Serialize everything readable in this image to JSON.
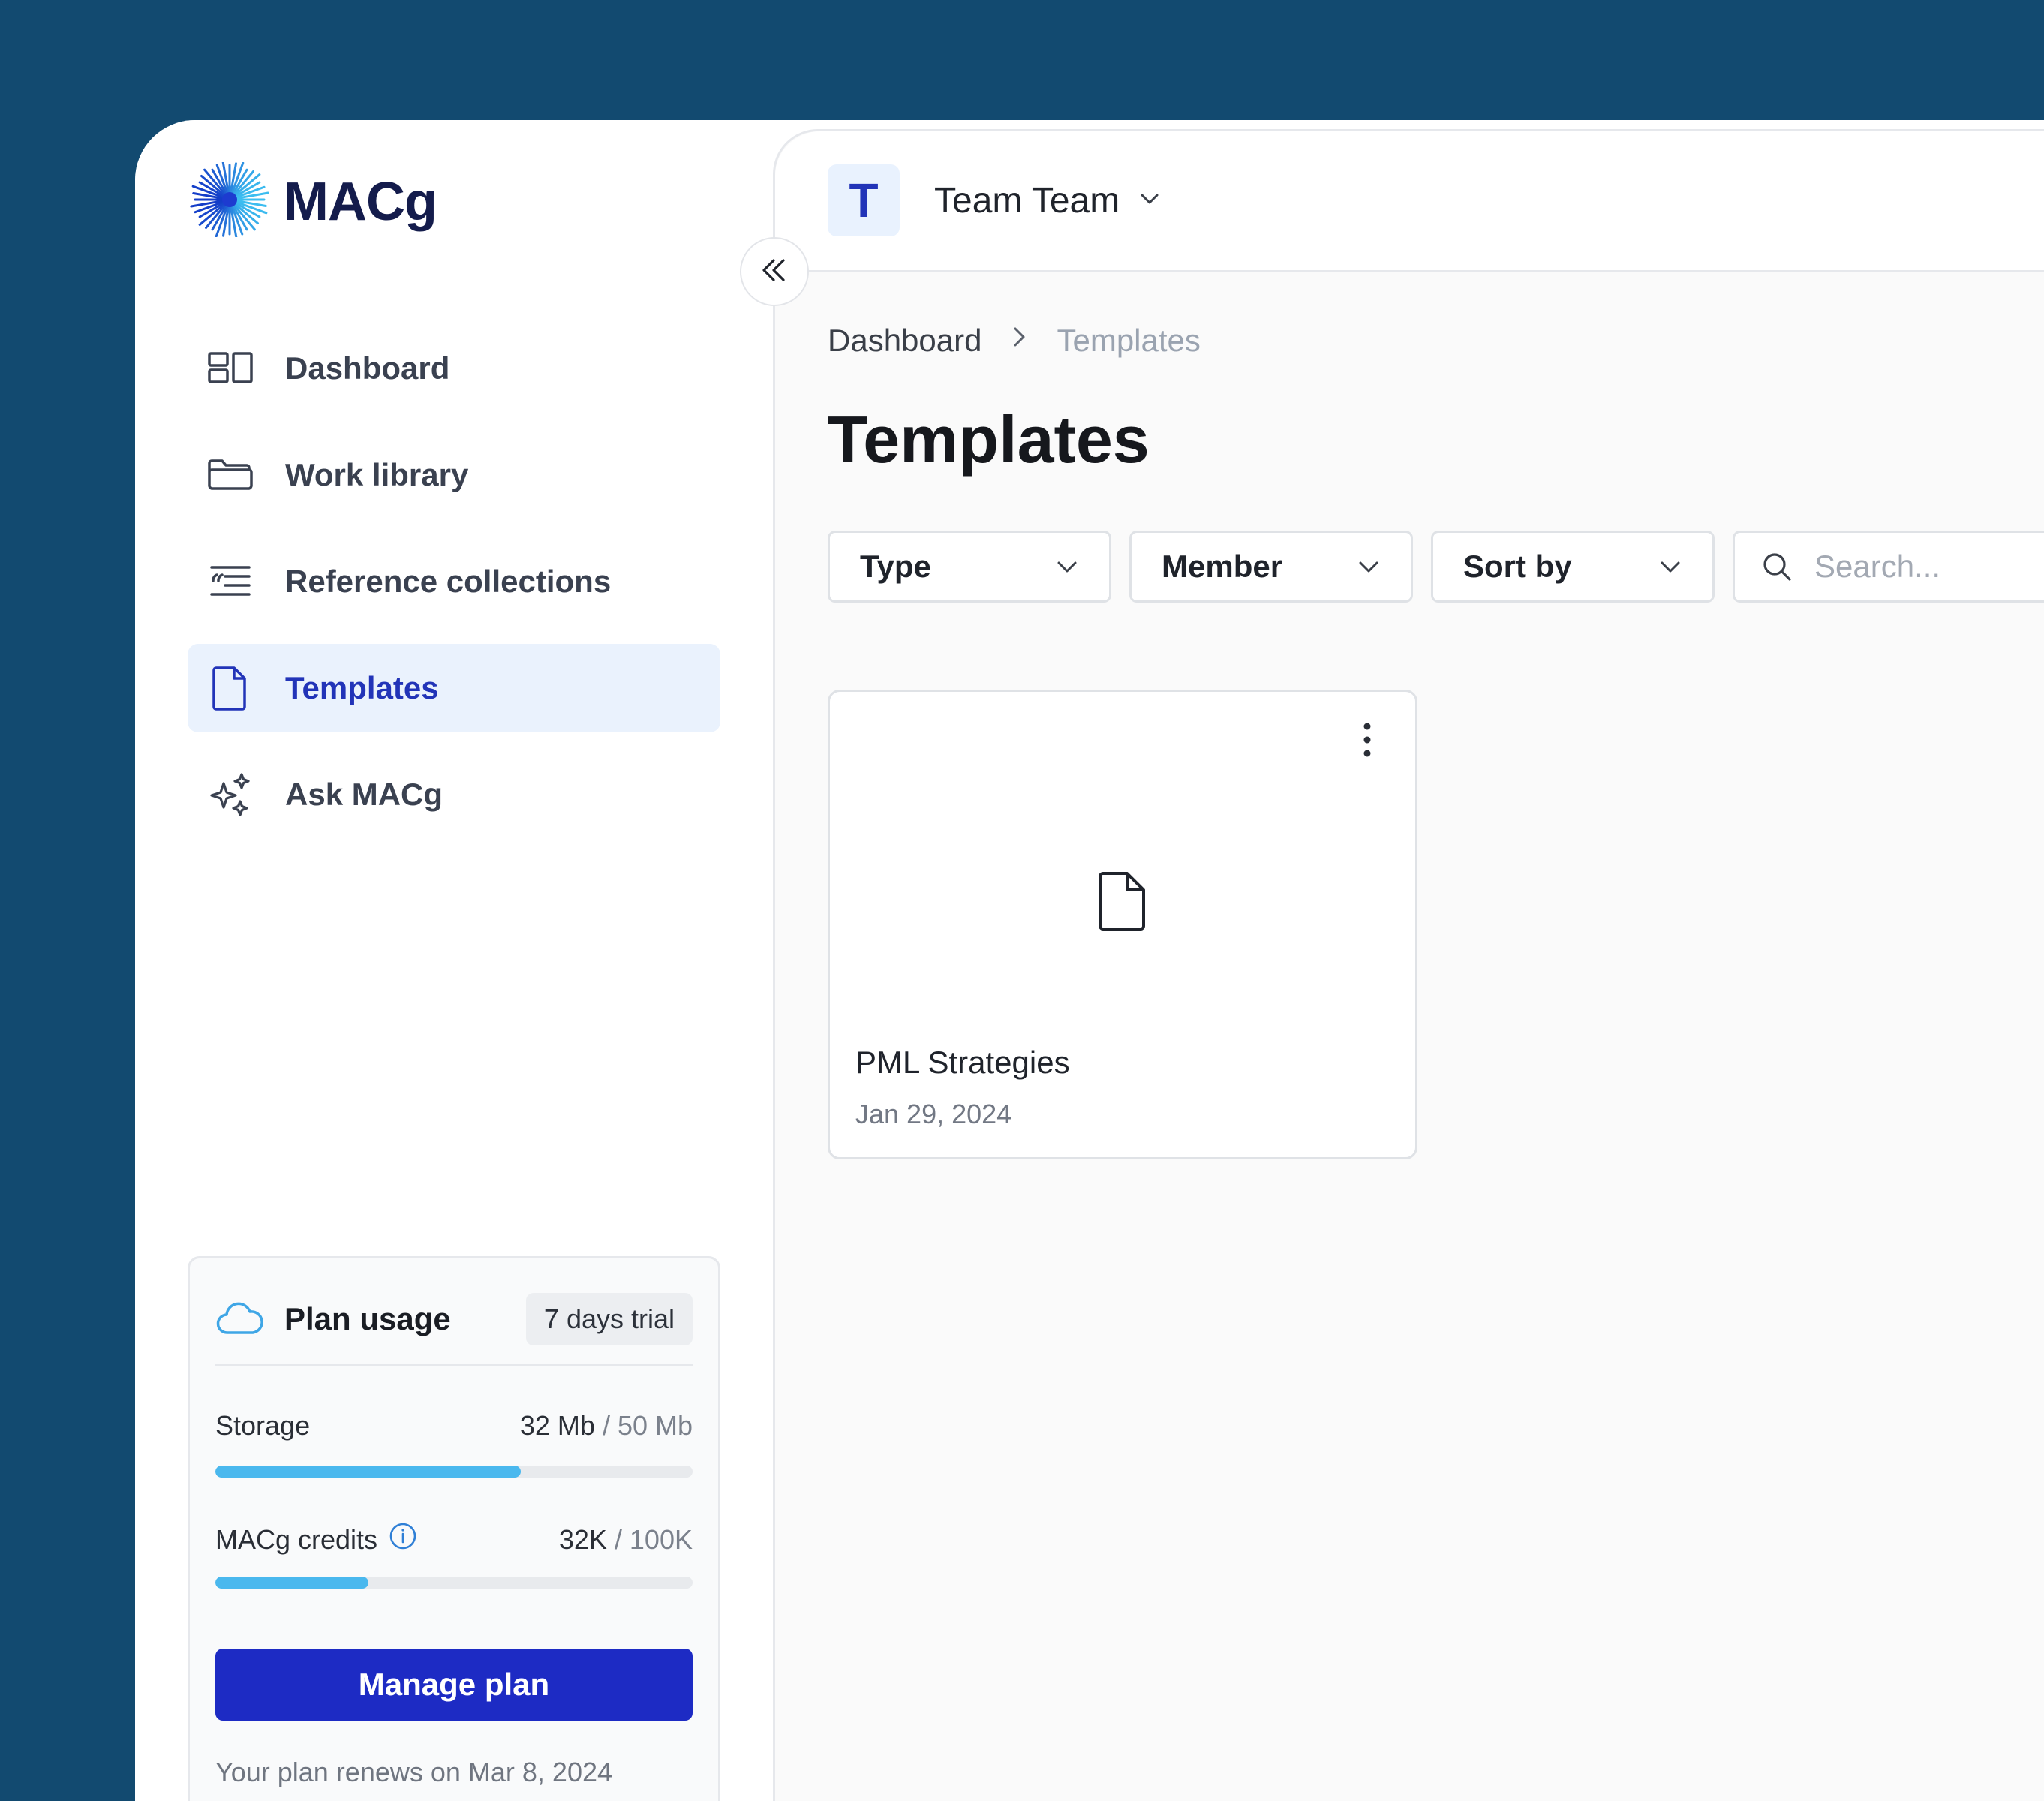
{
  "app": {
    "logo_text": "MACg",
    "logo_icon": "starburst-logo-icon",
    "brand_color": "#1d2bc4",
    "accent_color": "#4ab8ee"
  },
  "sidebar": {
    "collapse_icon": "chevrons-left-icon",
    "items": [
      {
        "label": "Dashboard",
        "icon": "dashboard-icon",
        "active": false
      },
      {
        "label": "Work library",
        "icon": "folder-icon",
        "active": false
      },
      {
        "label": "Reference collections",
        "icon": "quote-list-icon",
        "active": false
      },
      {
        "label": "Templates",
        "icon": "document-icon",
        "active": true
      },
      {
        "label": "Ask MACg",
        "icon": "sparkles-icon",
        "active": false
      }
    ],
    "plan": {
      "title": "Plan usage",
      "badge": "7 days trial",
      "storage": {
        "label": "Storage",
        "used": "32 Mb",
        "total": "/ 50 Mb",
        "fraction": 0.64
      },
      "credits": {
        "label": "MACg credits",
        "used": "32K",
        "total": "/ 100K",
        "fraction": 0.32
      },
      "manage_label": "Manage plan",
      "renew_text": "Your plan renews on Mar 8, 2024"
    }
  },
  "header": {
    "team_initial": "T",
    "team_name": "Team Team"
  },
  "main": {
    "breadcrumb": {
      "parent": "Dashboard",
      "current": "Templates"
    },
    "title": "Templates",
    "filters": {
      "type": "Type",
      "member": "Member",
      "sort": "Sort by"
    },
    "search": {
      "placeholder": "Search...",
      "value": ""
    },
    "templates": [
      {
        "title": "PML Strategies",
        "date": "Jan 29, 2024"
      }
    ]
  }
}
